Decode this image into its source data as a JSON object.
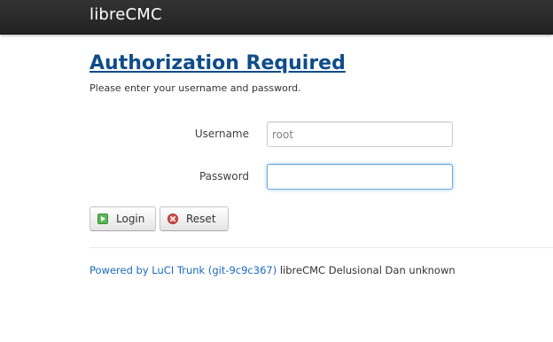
{
  "header": {
    "brand": "libreCMC"
  },
  "auth": {
    "title": "Authorization Required",
    "description": "Please enter your username and password.",
    "username_label": "Username",
    "username_value": "root",
    "password_label": "Password",
    "password_value": ""
  },
  "buttons": {
    "login_label": "Login",
    "login_icon": "apply-icon",
    "reset_label": "Reset",
    "reset_icon": "reset-icon"
  },
  "footer": {
    "link_text": "Powered by LuCI Trunk (git-9c9c367)",
    "suffix": "libreCMC Delusional Dan unknown"
  },
  "colors": {
    "topbar": "#222222",
    "title": "#0f4c8a",
    "link": "#1a6bbf",
    "focus_border": "#75a7d6",
    "login_icon_green": "#3c9c2a",
    "reset_icon_red": "#c62828"
  }
}
